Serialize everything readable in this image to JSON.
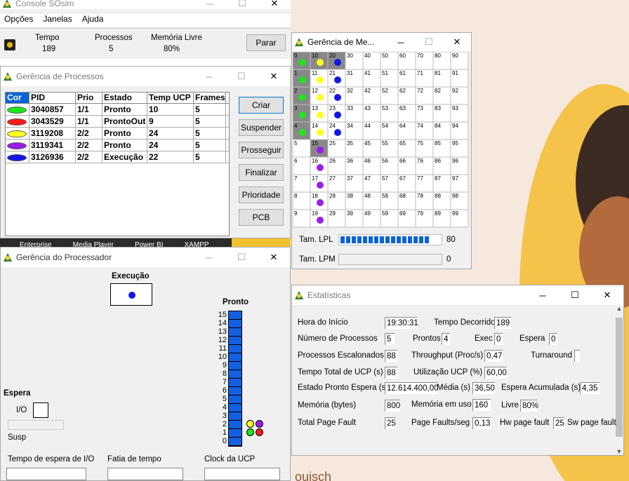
{
  "colors": {
    "green": "#1ee51e",
    "red": "#ff1b1b",
    "yellow": "#ffff1e",
    "purple": "#9b1ee8",
    "blue": "#1416e6",
    "pblue": "#1460e0",
    "accentYellow": "#f2c230",
    "skin": "#b36a3c"
  },
  "console": {
    "title": "Console SOsim",
    "menu": [
      "Opções",
      "Janelas",
      "Ajuda"
    ],
    "tempo_label": "Tempo",
    "tempo": "189",
    "processos_label": "Processos",
    "processos": "5",
    "memoria_label": "Memória Livre",
    "memoria": "80%",
    "parar": "Parar"
  },
  "proc_mgr": {
    "title": "Gerência de Processos",
    "headers": [
      "Cor",
      "PID",
      "Prio",
      "Estado",
      "Temp UCP",
      "Frames"
    ],
    "rows": [
      {
        "cor": "green",
        "pid": "3040857",
        "prio": "1/1",
        "estado": "Pronto",
        "temp": "10",
        "frames": "5"
      },
      {
        "cor": "red",
        "pid": "3043529",
        "prio": "1/1",
        "estado": "ProntoOut",
        "temp": "9",
        "frames": "5"
      },
      {
        "cor": "yellow",
        "pid": "3119208",
        "prio": "2/2",
        "estado": "Pronto",
        "temp": "24",
        "frames": "5"
      },
      {
        "cor": "purple",
        "pid": "3119341",
        "prio": "2/2",
        "estado": "Pronto",
        "temp": "24",
        "frames": "5"
      },
      {
        "cor": "blue",
        "pid": "3126936",
        "prio": "2/2",
        "estado": "Execução",
        "temp": "22",
        "frames": "5"
      }
    ],
    "buttons": [
      "Criar",
      "Suspender",
      "Prosseguir",
      "Finalizar",
      "Prioridade",
      "PCB"
    ]
  },
  "taskbar_strip": {
    "items": [
      "Enterprise",
      "Media Player",
      "Power BI",
      "XAMPP"
    ]
  },
  "processor": {
    "title": "Gerência do Processador",
    "execucao": "Execução",
    "pronto": "Pronto",
    "queue_numbers": [
      "15",
      "14",
      "13",
      "12",
      "11",
      "10",
      "9",
      "8",
      "7",
      "6",
      "5",
      "4",
      "3",
      "2",
      "1",
      "0"
    ],
    "espera": "Espera",
    "io": "I/O",
    "susp": "Susp",
    "tempo_espera_io": "Tempo de espera de I/O",
    "fatia_tempo": "Fatia de tempo",
    "clock_ucp": "Clock da UCP"
  },
  "mem_mgr": {
    "title": "Gerência de Me...",
    "grid": [
      [
        "0",
        "10",
        "20",
        "30",
        "40",
        "50",
        "60",
        "70",
        "80",
        "90"
      ],
      [
        "1",
        "11",
        "21",
        "31",
        "41",
        "51",
        "61",
        "71",
        "81",
        "91"
      ],
      [
        "2",
        "12",
        "22",
        "32",
        "42",
        "52",
        "62",
        "72",
        "82",
        "92"
      ],
      [
        "3",
        "13",
        "23",
        "33",
        "43",
        "53",
        "63",
        "73",
        "83",
        "93"
      ],
      [
        "4",
        "14",
        "24",
        "34",
        "44",
        "54",
        "64",
        "74",
        "84",
        "94"
      ],
      [
        "5",
        "15",
        "25",
        "35",
        "45",
        "55",
        "65",
        "75",
        "85",
        "95"
      ],
      [
        "6",
        "16",
        "26",
        "36",
        "46",
        "56",
        "66",
        "76",
        "86",
        "96"
      ],
      [
        "7",
        "17",
        "27",
        "37",
        "47",
        "57",
        "67",
        "77",
        "87",
        "97"
      ],
      [
        "8",
        "18",
        "28",
        "38",
        "48",
        "58",
        "68",
        "78",
        "88",
        "98"
      ],
      [
        "9",
        "19",
        "29",
        "39",
        "49",
        "59",
        "69",
        "79",
        "89",
        "99"
      ]
    ],
    "tam_lpl": "Tam. LPL",
    "tam_lpl_val": "80",
    "lpl_segments": 16,
    "tam_lpm": "Tam. LPM",
    "tam_lpm_val": "0"
  },
  "stats": {
    "title": "Estatísticas",
    "hora_inicio_label": "Hora do Início",
    "hora_inicio": "19:30:31",
    "tempo_decorrido_label": "Tempo Decorrido",
    "tempo_decorrido": "189",
    "num_proc_label": "Número de Processos",
    "num_proc": "5",
    "prontos_label": "Prontos",
    "prontos": "4",
    "exec_label": "Exec",
    "exec": "0",
    "espera_label": "Espera",
    "espera": "0",
    "escalonados_label": "Processos Escalonados",
    "escalonados": "88",
    "throughput_label": "Throughput (Proc/s)",
    "throughput": "0,47",
    "turnaround_label": "Turnaround",
    "turnaround": "",
    "tempo_total_label": "Tempo Total de UCP (s)",
    "tempo_total": "88",
    "utilizacao_label": "Utilização UCP (%)",
    "utilizacao": "60,00",
    "estado_pronto_label": "Estado Pronto Espera (s)",
    "estado_pronto": "12.614.400,00",
    "media_label": "Média (s)",
    "media": "36,50",
    "espera_acum_label": "Espera Acumulada (s)",
    "espera_acum": "4,35",
    "memoria_label": "Memória (bytes)",
    "memoria": "800",
    "mem_uso_label": "Memória em uso",
    "mem_uso": "160",
    "livre_label": "Livre",
    "livre": "80%",
    "page_fault_label": "Total Page Fault",
    "page_fault": "25",
    "pf_seg_label": "Page Faults/seg",
    "pf_seg": "0,13",
    "hw_label": "Hw page fault",
    "hw": "25",
    "sw_label": "Sw page fault"
  },
  "bg_text": "ouisch"
}
